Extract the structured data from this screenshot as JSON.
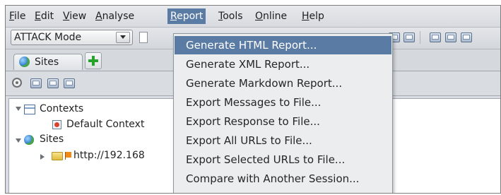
{
  "menubar": {
    "items": [
      {
        "mnemonic": "F",
        "rest": "ile"
      },
      {
        "mnemonic": "E",
        "rest": "dit"
      },
      {
        "mnemonic": "V",
        "rest": "iew"
      },
      {
        "mnemonic": "A",
        "rest": "nalyse"
      },
      {
        "mnemonic": "R",
        "rest": "eport"
      },
      {
        "mnemonic": "T",
        "rest": "ools"
      },
      {
        "mnemonic": "O",
        "rest": "nline"
      },
      {
        "mnemonic": "H",
        "rest": "elp"
      }
    ],
    "active": "Report"
  },
  "toolbar": {
    "mode_select": "ATTACK Mode"
  },
  "tabs": {
    "sites_label": "Sites"
  },
  "tree": {
    "contexts": "Contexts",
    "default_context": "Default Context",
    "sites": "Sites",
    "site_url": "http://192.168"
  },
  "report_menu": {
    "items": [
      "Generate HTML Report...",
      "Generate XML Report...",
      "Generate Markdown Report...",
      "Export Messages to File...",
      "Export Response to File...",
      "Export All URLs to File...",
      "Export Selected URLs to File...",
      "Compare with Another Session..."
    ],
    "selected_index": 0
  },
  "colors": {
    "highlight": "#5a7ba4",
    "menu_background": "#ecedef",
    "window_background": "#d9dde3"
  }
}
